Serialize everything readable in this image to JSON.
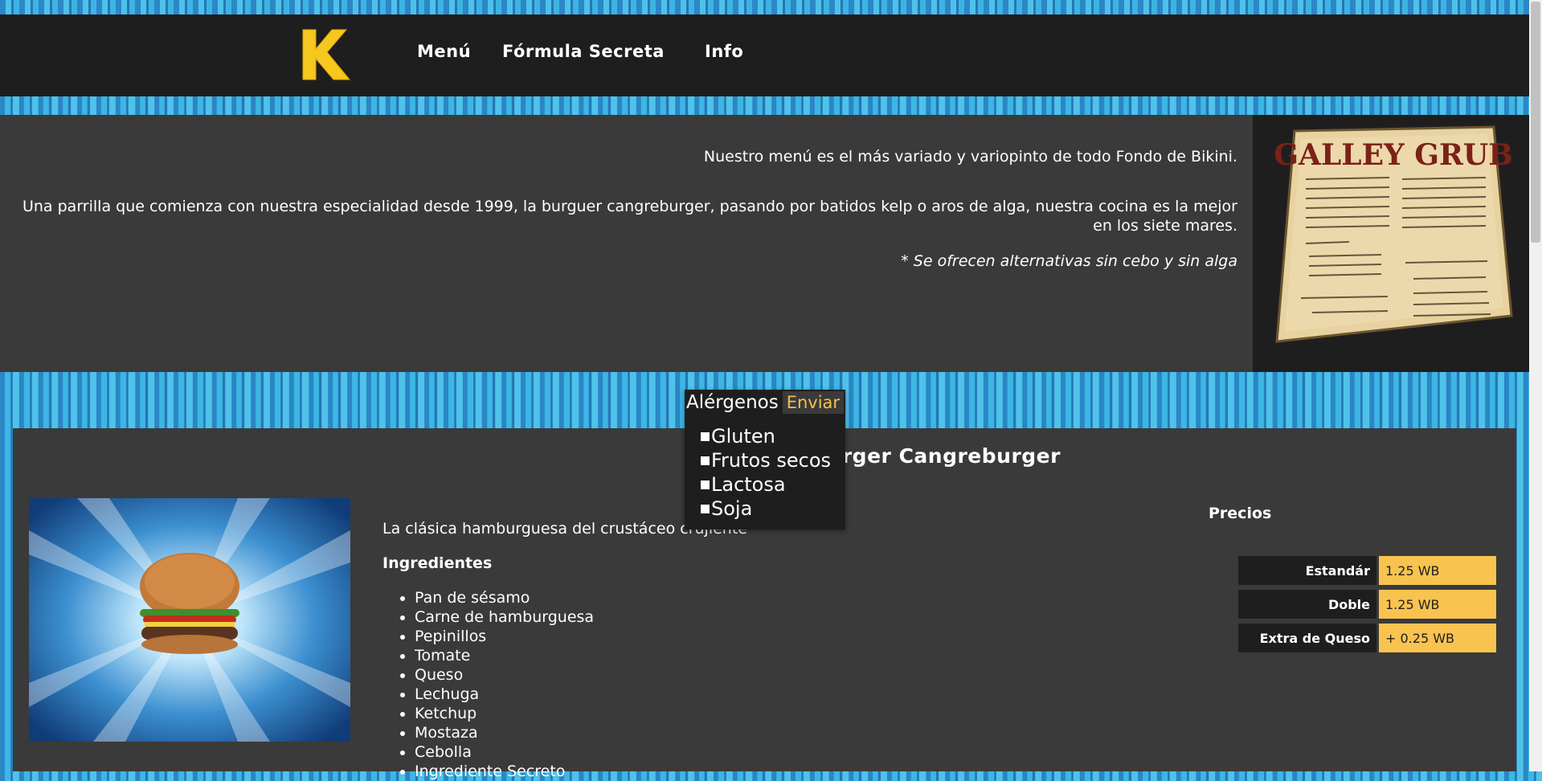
{
  "nav": {
    "logo_letter": "K",
    "links": [
      "Menú",
      "Fórmula Secreta",
      "Info"
    ]
  },
  "intro": {
    "line1": "Nuestro menú es el más variado y variopinto de todo Fondo de Bikini.",
    "line2": "Una parrilla que comienza con nuestra especialidad desde 1999, la burguer cangreburger, pasando por batidos kelp o aros de alga, nuestra cocina es la mejor en los siete mares.",
    "line3": "* Se ofrecen alternativas sin cebo y sin alga",
    "menu_board_title": "GALLEY GRUB"
  },
  "allergens": {
    "title": "Alérgenos",
    "send_label": "Enviar",
    "options": [
      "Gluten",
      "Frutos secos",
      "Lactosa",
      "Soja"
    ]
  },
  "product": {
    "title": "Burger Cangreburger",
    "description": "La clásica hamburguesa del crustáceo crujiente",
    "ingredients_heading": "Ingredientes",
    "ingredients": [
      "Pan de sésamo",
      "Carne de hamburguesa",
      "Pepinillos",
      "Tomate",
      "Queso",
      "Lechuga",
      "Ketchup",
      "Mostaza",
      "Cebolla",
      "Ingrediente Secreto"
    ],
    "prices_heading": "Precios",
    "prices": [
      {
        "label": "Estandár",
        "value": "1.25 WB"
      },
      {
        "label": "Doble",
        "value": "1.25 WB"
      },
      {
        "label": "Extra de Queso",
        "value": "+ 0.25 WB"
      }
    ]
  },
  "colors": {
    "accent": "#f9c34f",
    "dark": "#1f1e1f",
    "panel": "#3a3a3a",
    "ocean": "#35b3e0"
  }
}
